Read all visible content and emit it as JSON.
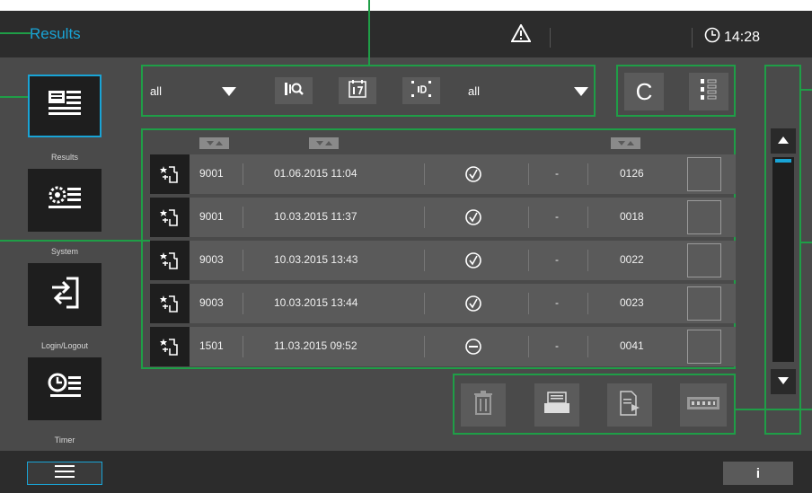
{
  "header": {
    "title": "Results",
    "time": "14:28",
    "warning_icon": "warning-icon",
    "clock_icon": "clock-icon"
  },
  "sidebar": {
    "items": [
      {
        "label": "Results",
        "icon": "results-list-icon",
        "active": true
      },
      {
        "label": "System",
        "icon": "system-settings-icon",
        "active": false
      },
      {
        "label": "Login/Logout",
        "icon": "login-logout-icon",
        "active": false
      },
      {
        "label": "Timer",
        "icon": "timer-icon",
        "active": false
      }
    ]
  },
  "filters": {
    "left_select": "all",
    "right_select": "all"
  },
  "table": {
    "rows": [
      {
        "col1": "9001",
        "datetime": "01.06.2015 11:04",
        "status": "ok",
        "dash": "-",
        "num": "0126"
      },
      {
        "col1": "9001",
        "datetime": "10.03.2015 11:37",
        "status": "ok",
        "dash": "-",
        "num": "0018"
      },
      {
        "col1": "9003",
        "datetime": "10.03.2015 13:43",
        "status": "ok",
        "dash": "-",
        "num": "0022"
      },
      {
        "col1": "9003",
        "datetime": "10.03.2015 13:44",
        "status": "ok",
        "dash": "-",
        "num": "0023"
      },
      {
        "col1": "1501",
        "datetime": "11.03.2015 09:52",
        "status": "minus",
        "dash": "-",
        "num": "0041"
      }
    ]
  },
  "top_right": {
    "c_label": "C"
  },
  "footer": {
    "info_label": "i",
    "menu_icon": "menu-icon"
  },
  "colors": {
    "accent": "#19a4d6",
    "annotation": "#1f9e47",
    "header_bg": "#2c2c2c",
    "body_bg": "#4a4a4a"
  }
}
